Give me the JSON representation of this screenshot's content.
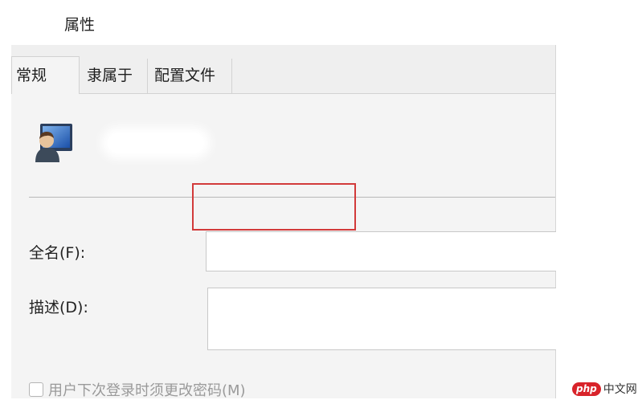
{
  "window": {
    "title": "属性"
  },
  "tabs": [
    {
      "label": "常规",
      "active": true
    },
    {
      "label": "隶属于",
      "active": false
    },
    {
      "label": "配置文件",
      "active": false
    }
  ],
  "user": {
    "icon": "user-computer-icon"
  },
  "form": {
    "fullname_label": "全名(F):",
    "fullname_value": "",
    "description_label": "描述(D):",
    "description_value": "",
    "change_password_label": "用户下次登录时须更改密码(M)",
    "change_password_checked": false
  },
  "annotation": {
    "highlight_color": "#d23a3a"
  },
  "watermark": {
    "badge": "php",
    "site": "中文网"
  }
}
